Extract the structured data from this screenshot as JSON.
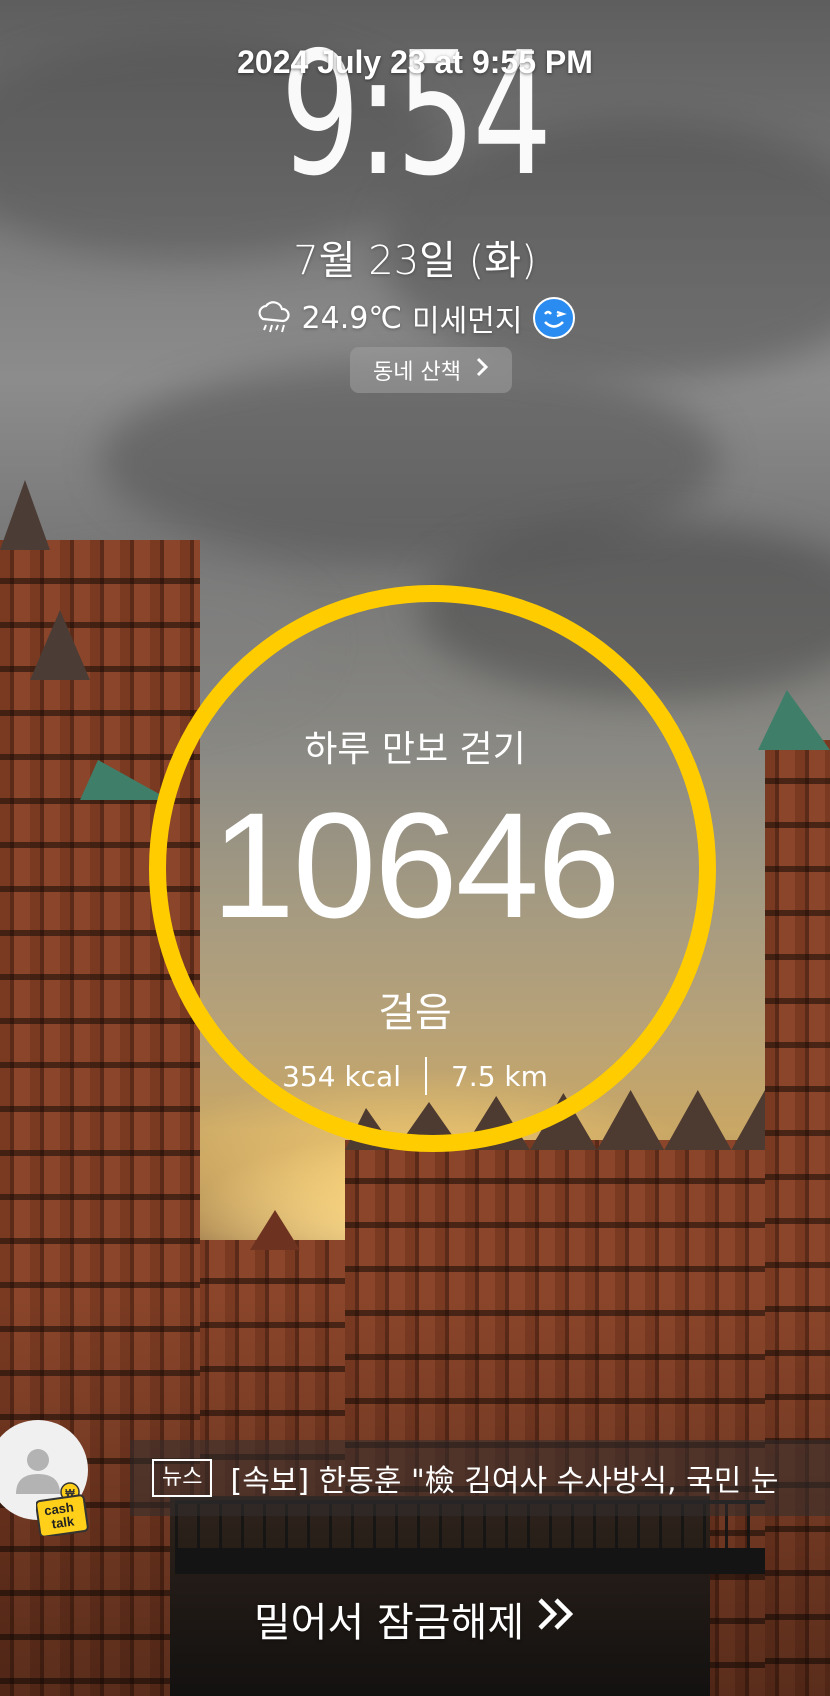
{
  "screenshot_timestamp": "2024 July 23 at 9:55 PM",
  "clock": {
    "time": "9:54"
  },
  "date": "7월 23일 (화)",
  "weather": {
    "icon": "rain-cloud-icon",
    "temperature": "24.9℃",
    "dust_label": "미세먼지",
    "dust_icon": "smiley-face-icon",
    "dust_color": "#2a8cf0"
  },
  "walk_chip": {
    "label": "동네 산책",
    "icon": "chevron-right-icon"
  },
  "pedometer": {
    "title": "하루 만보 걷기",
    "steps": "10646",
    "unit": "걸음",
    "kcal": "354 kcal",
    "distance": "7.5 km",
    "ring_color": "#ffcc00"
  },
  "news": {
    "tag": "뉴스",
    "headline": "[속보] 한동훈 \"檢 김여사 수사방식, 국민 눈",
    "badge": "cash talk"
  },
  "unlock": {
    "label": "밀어서 잠금해제",
    "icon": "double-chevron-right-icon"
  }
}
